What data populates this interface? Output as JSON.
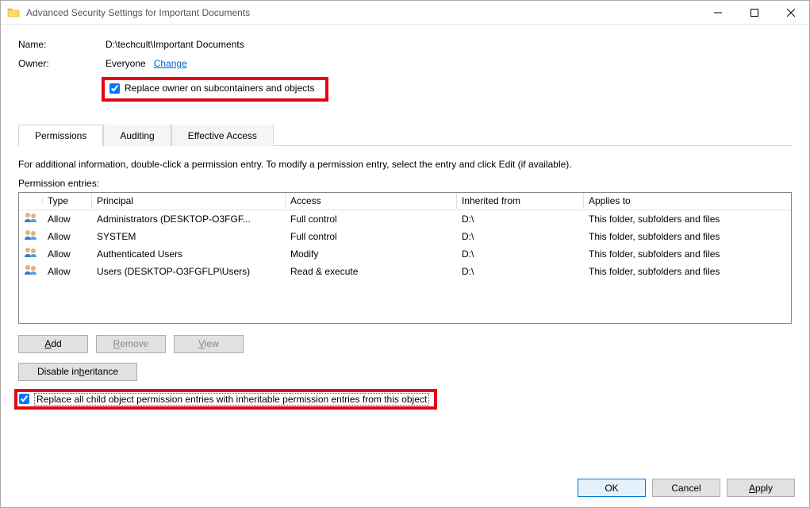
{
  "window": {
    "title": "Advanced Security Settings for Important Documents"
  },
  "header": {
    "name_label": "Name:",
    "name_value": "D:\\techcult\\Important Documents",
    "owner_label": "Owner:",
    "owner_value": "Everyone",
    "change_link": "Change",
    "replace_owner_label": "Replace owner on subcontainers and objects",
    "replace_owner_checked": true
  },
  "tabs": {
    "permissions": "Permissions",
    "auditing": "Auditing",
    "effective": "Effective Access"
  },
  "main": {
    "info_text": "For additional information, double-click a permission entry. To modify a permission entry, select the entry and click Edit (if available).",
    "entries_label": "Permission entries:",
    "columns": {
      "type": "Type",
      "principal": "Principal",
      "access": "Access",
      "inherited": "Inherited from",
      "applies": "Applies to"
    },
    "rows": [
      {
        "type": "Allow",
        "principal": "Administrators (DESKTOP-O3FGF...",
        "access": "Full control",
        "inherited": "D:\\",
        "applies": "This folder, subfolders and files"
      },
      {
        "type": "Allow",
        "principal": "SYSTEM",
        "access": "Full control",
        "inherited": "D:\\",
        "applies": "This folder, subfolders and files"
      },
      {
        "type": "Allow",
        "principal": "Authenticated Users",
        "access": "Modify",
        "inherited": "D:\\",
        "applies": "This folder, subfolders and files"
      },
      {
        "type": "Allow",
        "principal": "Users (DESKTOP-O3FGFLP\\Users)",
        "access": "Read & execute",
        "inherited": "D:\\",
        "applies": "This folder, subfolders and files"
      }
    ],
    "buttons": {
      "add_prefix": "A",
      "add_rest": "dd",
      "remove_prefix": "R",
      "remove_rest": "emove",
      "view_prefix": "V",
      "view_rest": "iew",
      "disable_prefix_pre": "Disable in",
      "disable_u": "h",
      "disable_post": "eritance"
    },
    "replace_children_label": "Replace all child object permission entries with inheritable permission entries from this object",
    "replace_children_checked": true
  },
  "footer": {
    "ok": "OK",
    "cancel": "Cancel",
    "apply_prefix": "A",
    "apply_rest": "pply"
  }
}
